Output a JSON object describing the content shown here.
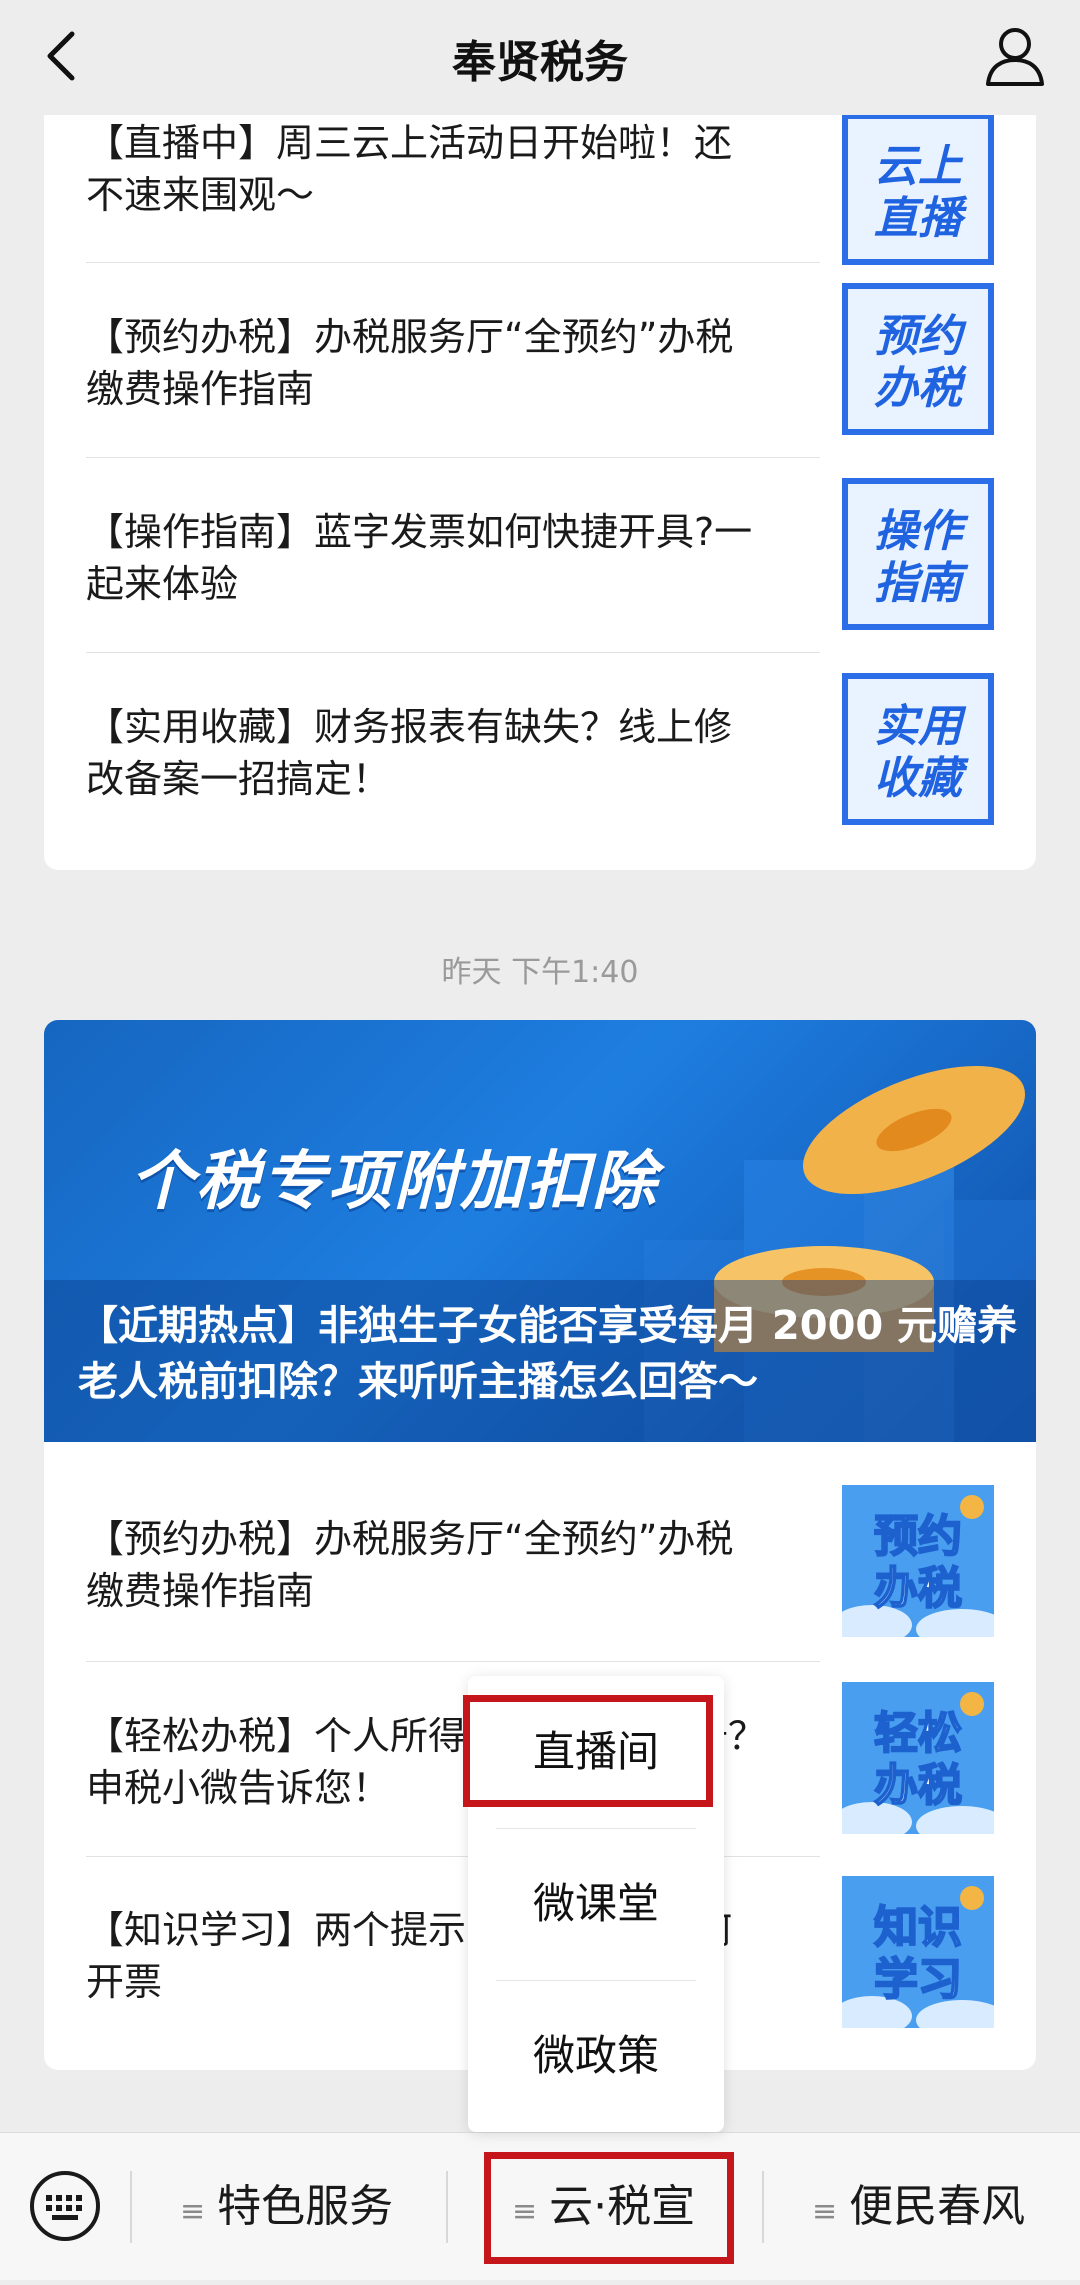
{
  "header": {
    "title": "奉贤税务"
  },
  "card1": {
    "items": [
      {
        "text": "【直播中】周三云上活动日开始啦！还不速来围观～",
        "thumb_lines": [
          "云上",
          "直播"
        ]
      },
      {
        "text": "【预约办税】办税服务厅“全预约”办税缴费操作指南",
        "thumb_lines": [
          "预约",
          "办税"
        ]
      },
      {
        "text": "【操作指南】蓝字发票如何快捷开具?一起来体验",
        "thumb_lines": [
          "操作",
          "指南"
        ]
      },
      {
        "text": "【实用收藏】财务报表有缺失？线上修改备案一招搞定！",
        "thumb_lines": [
          "实用",
          "收藏"
        ]
      }
    ]
  },
  "timestamp": "昨天 下午1:40",
  "card2": {
    "banner_title": "个税专项附加扣除",
    "banner_caption": "【近期热点】非独生子女能否享受每月 2000 元赡养老人税前扣除？来听听主播怎么回答～",
    "items": [
      {
        "text": "【预约办税】办税服务厅“全预约”办税缴费操作指南",
        "thumb_lines": [
          "预约",
          "办税"
        ]
      },
      {
        "text": "【轻松办税】个人所得税APP如何注册？申税小微告诉您！",
        "thumb_lines": [
          "轻松",
          "办税"
        ]
      },
      {
        "text": "【知识学习】两个提示：数电发票如何开票",
        "thumb_lines": [
          "知识",
          "学习"
        ]
      }
    ]
  },
  "popup_menu": {
    "items": [
      "直播间",
      "微课堂",
      "微政策"
    ]
  },
  "bottom_menu": {
    "tabs": [
      "特色服务",
      "云·税宣",
      "便民春风"
    ],
    "menu_glyph": "≡"
  },
  "colors": {
    "highlight": "#c5161c",
    "thumb_blue": "#2b6ee8"
  }
}
